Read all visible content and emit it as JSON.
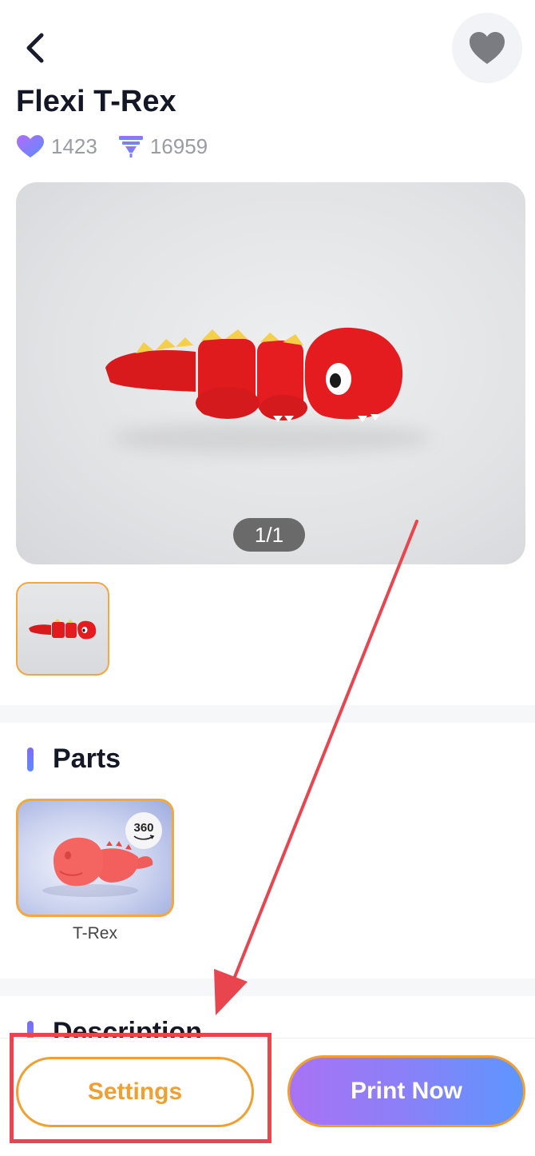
{
  "header": {
    "back_icon": "chevron-left-icon",
    "favorite_icon": "heart-icon"
  },
  "model": {
    "title": "Flexi T-Rex",
    "likes": "1423",
    "prints": "16959",
    "image_counter": "1/1"
  },
  "sections": {
    "parts_title": "Parts",
    "description_title": "Description"
  },
  "parts": [
    {
      "label": "T-Rex",
      "badge": "360"
    }
  ],
  "actions": {
    "settings_label": "Settings",
    "print_label": "Print Now"
  },
  "colors": {
    "accent_orange": "#f0a030",
    "gradient_start": "#a873f5",
    "gradient_end": "#5d96ff",
    "annotation_red": "#e8454f",
    "dino_red": "#e0191c",
    "dino_yellow": "#f4cf4a"
  }
}
